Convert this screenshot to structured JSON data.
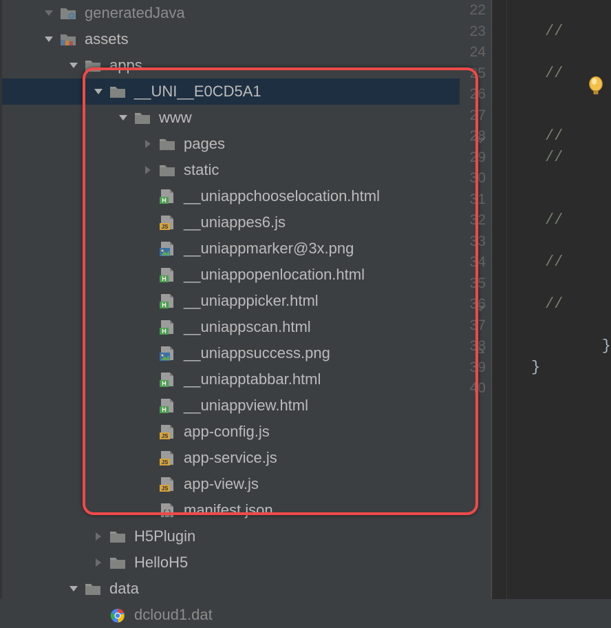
{
  "tree": {
    "rows": [
      {
        "indent": 46,
        "chevron": "down-dark",
        "icon": "folder-gear",
        "label": "generatedJava",
        "cut": true
      },
      {
        "indent": 46,
        "chevron": "down-light",
        "icon": "folder-res",
        "label": "assets"
      },
      {
        "indent": 82,
        "chevron": "down-light",
        "icon": "folder",
        "label": "apps"
      },
      {
        "indent": 118,
        "chevron": "down-light",
        "icon": "folder",
        "label": "__UNI__E0CD5A1",
        "selected": true
      },
      {
        "indent": 154,
        "chevron": "down-light",
        "icon": "folder",
        "label": "www"
      },
      {
        "indent": 190,
        "chevron": "right-dark",
        "icon": "folder",
        "label": "pages"
      },
      {
        "indent": 190,
        "chevron": "right-dark",
        "icon": "folder",
        "label": "static"
      },
      {
        "indent": 190,
        "chevron": "none",
        "icon": "html",
        "label": "__uniappchooselocation.html"
      },
      {
        "indent": 190,
        "chevron": "none",
        "icon": "js",
        "label": "__uniappes6.js"
      },
      {
        "indent": 190,
        "chevron": "none",
        "icon": "image",
        "label": "__uniappmarker@3x.png"
      },
      {
        "indent": 190,
        "chevron": "none",
        "icon": "html",
        "label": "__uniappopenlocation.html"
      },
      {
        "indent": 190,
        "chevron": "none",
        "icon": "html",
        "label": "__uniapppicker.html"
      },
      {
        "indent": 190,
        "chevron": "none",
        "icon": "html",
        "label": "__uniappscan.html"
      },
      {
        "indent": 190,
        "chevron": "none",
        "icon": "image",
        "label": "__uniappsuccess.png"
      },
      {
        "indent": 190,
        "chevron": "none",
        "icon": "html",
        "label": "__uniapptabbar.html"
      },
      {
        "indent": 190,
        "chevron": "none",
        "icon": "html",
        "label": "__uniappview.html"
      },
      {
        "indent": 190,
        "chevron": "none",
        "icon": "js",
        "label": "app-config.js"
      },
      {
        "indent": 190,
        "chevron": "none",
        "icon": "js",
        "label": "app-service.js"
      },
      {
        "indent": 190,
        "chevron": "none",
        "icon": "js",
        "label": "app-view.js"
      },
      {
        "indent": 190,
        "chevron": "none",
        "icon": "json",
        "label": "manifest.json"
      },
      {
        "indent": 118,
        "chevron": "right-dark",
        "icon": "folder",
        "label": "H5Plugin"
      },
      {
        "indent": 118,
        "chevron": "right-dark",
        "icon": "folder",
        "label": "HelloH5"
      },
      {
        "indent": 82,
        "chevron": "down-light",
        "icon": "folder",
        "label": "data"
      },
      {
        "indent": 118,
        "chevron": "none",
        "icon": "chrome",
        "label": "dcloud1.dat",
        "cut": true
      }
    ]
  },
  "gutter": {
    "start": 22,
    "end": 40,
    "foldMarkers": {
      "28": "open",
      "36": "open",
      "38": "close"
    }
  },
  "editor": {
    "lines": [
      {
        "n": 22,
        "text": ""
      },
      {
        "n": 23,
        "text": "//",
        "cls": "comment"
      },
      {
        "n": 24,
        "text": ""
      },
      {
        "n": 25,
        "text": "//",
        "cls": "comment"
      },
      {
        "n": 26,
        "text": ""
      },
      {
        "n": 27,
        "text": ""
      },
      {
        "n": 28,
        "text": "//",
        "cls": "comment"
      },
      {
        "n": 29,
        "text": "//",
        "cls": "comment"
      },
      {
        "n": 30,
        "text": ""
      },
      {
        "n": 31,
        "text": ""
      },
      {
        "n": 32,
        "text": "//",
        "cls": "comment"
      },
      {
        "n": 33,
        "text": ""
      },
      {
        "n": 34,
        "text": "//",
        "cls": "comment"
      },
      {
        "n": 35,
        "text": ""
      },
      {
        "n": 36,
        "text": "//",
        "cls": "comment"
      },
      {
        "n": 37,
        "text": ""
      },
      {
        "n": 38,
        "text": "    }",
        "cls": "brace"
      },
      {
        "n": 39,
        "text": "}",
        "cls": "brace"
      },
      {
        "n": 40,
        "text": ""
      }
    ]
  }
}
